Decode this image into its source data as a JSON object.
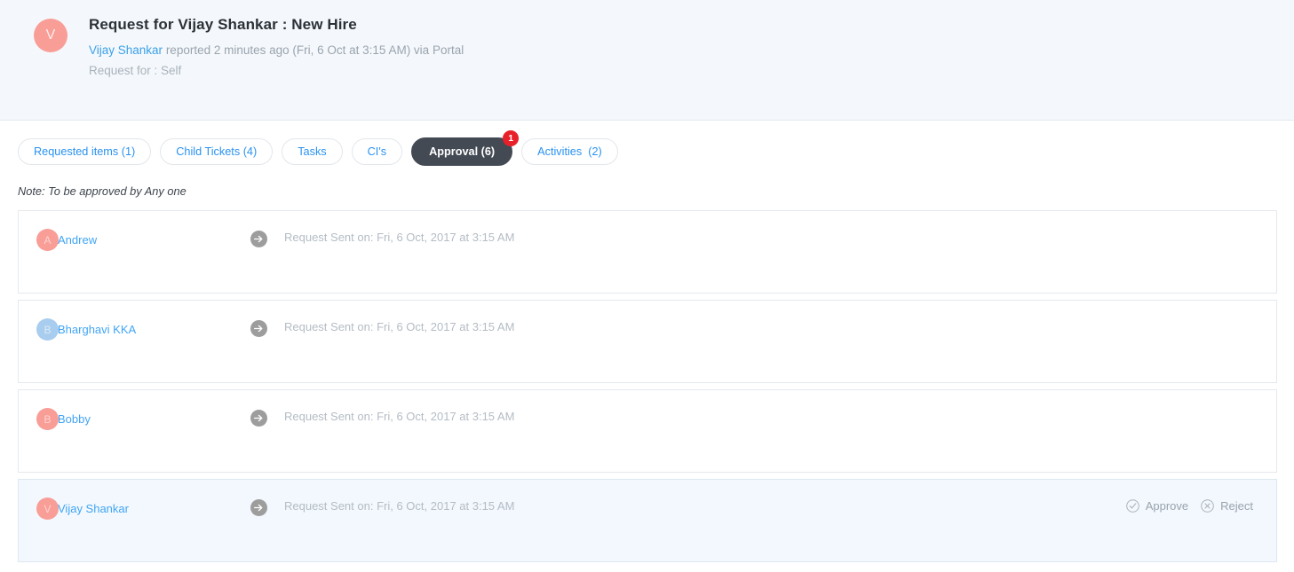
{
  "header": {
    "avatar_initial": "V",
    "title": "Request for Vijay Shankar : New Hire",
    "requester_link": "Vijay Shankar",
    "reported_text": " reported 2 minutes ago (Fri, 6 Oct at 3:15 AM) via Portal",
    "request_for": "Request for : Self"
  },
  "tabs": [
    {
      "label": "Requested items (1)",
      "active": false,
      "badge": null
    },
    {
      "label": "Child Tickets (4)",
      "active": false,
      "badge": null
    },
    {
      "label": "Tasks",
      "active": false,
      "badge": null
    },
    {
      "label": "CI's",
      "active": false,
      "badge": null
    },
    {
      "label": "Approval (6)",
      "active": true,
      "badge": "1"
    },
    {
      "label": "Activities  (2)",
      "active": false,
      "badge": null
    }
  ],
  "note": "Note: To be approved by Any one",
  "approvals": [
    {
      "initial": "A",
      "avatar_color": "pink",
      "name": "Andrew",
      "status": "Request Sent on: Fri, 6 Oct, 2017 at 3:15 AM",
      "highlighted": false,
      "actions": []
    },
    {
      "initial": "B",
      "avatar_color": "blue",
      "name": "Bharghavi KKA",
      "status": "Request Sent on: Fri, 6 Oct, 2017 at 3:15 AM",
      "highlighted": false,
      "actions": []
    },
    {
      "initial": "B",
      "avatar_color": "pink",
      "name": "Bobby",
      "status": "Request Sent on: Fri, 6 Oct, 2017 at 3:15 AM",
      "highlighted": false,
      "actions": []
    },
    {
      "initial": "V",
      "avatar_color": "pink",
      "name": "Vijay Shankar",
      "status": "Request Sent on: Fri, 6 Oct, 2017 at 3:15 AM",
      "highlighted": true,
      "actions": [
        {
          "label": "Approve",
          "icon": "check-circle-icon"
        },
        {
          "label": "Reject",
          "icon": "x-circle-icon"
        }
      ]
    }
  ],
  "colors": {
    "accent_link": "#42a5f5",
    "active_tab_bg": "#434a54",
    "badge_red": "#e8202a",
    "avatar_pink": "#f99d97",
    "avatar_blue": "#a9cdee",
    "header_bg": "#f4f8fc",
    "highlight_row_bg": "#f2f8fd"
  }
}
